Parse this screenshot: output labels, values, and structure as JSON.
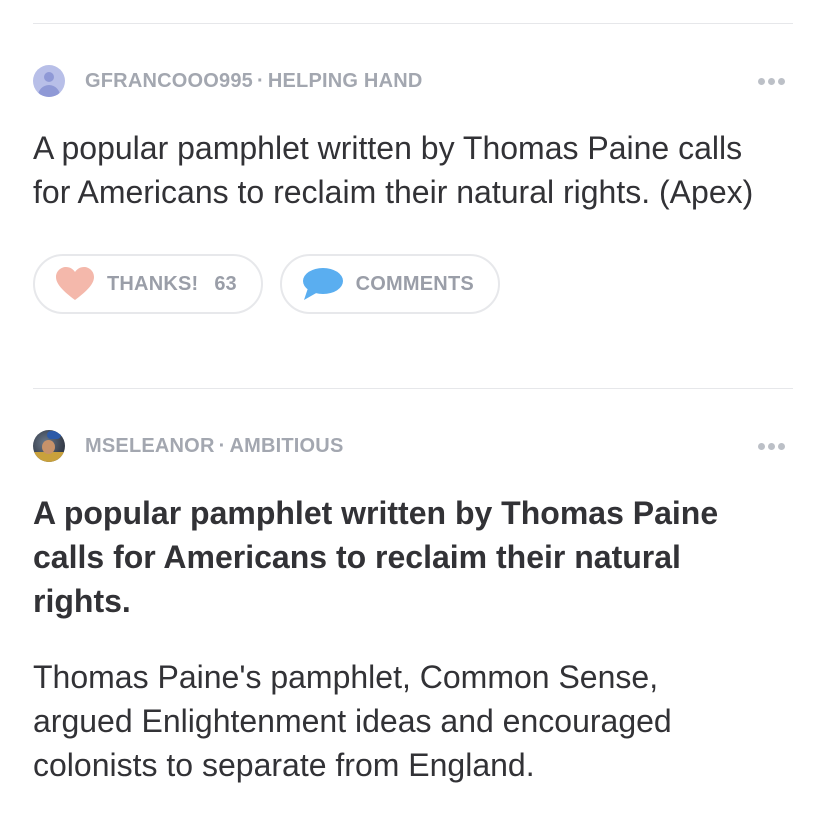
{
  "answers": [
    {
      "author": "GFRANCOOO995",
      "rank": "HELPING HAND",
      "separator": "·",
      "avatar": "default-user-icon",
      "body": "A popular pamphlet written by Thomas Paine calls for Americans to reclaim their natural rights. (Apex)",
      "thanks_label": "THANKS!",
      "thanks_count": "63",
      "comments_label": "COMMENTS"
    },
    {
      "author": "MSELEANOR",
      "rank": "AMBITIOUS",
      "separator": "·",
      "avatar": "photo-avatar",
      "headline": "A popular pamphlet written by Thomas Paine calls for Americans to reclaim their natural rights.",
      "body": "Thomas Paine's pamphlet, Common Sense, argued Enlightenment ideas and encouraged colonists to separate from England."
    }
  ],
  "colors": {
    "heart": "#f4b8ab",
    "comment_bubble": "#5aaef0",
    "meta_text": "#a3a7b0"
  }
}
